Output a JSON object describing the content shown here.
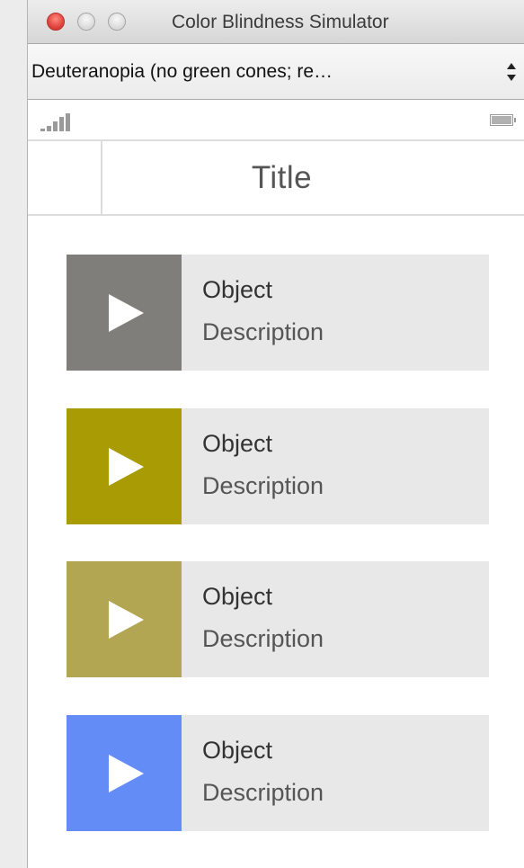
{
  "window": {
    "title": "Color Blindness Simulator"
  },
  "simulation_select": {
    "selected": "Deuteranopia (no green cones; re…"
  },
  "status_bar": {
    "signal_icon": "signal-strength-icon",
    "battery_icon": "battery-icon"
  },
  "nav": {
    "title": "Title"
  },
  "items": [
    {
      "title": "Object",
      "description": "Description",
      "color": "#7f7e7a",
      "icon": "play-icon"
    },
    {
      "title": "Object",
      "description": "Description",
      "color": "#a89b04",
      "icon": "play-icon"
    },
    {
      "title": "Object",
      "description": "Description",
      "color": "#b3a653",
      "icon": "play-icon"
    },
    {
      "title": "Object",
      "description": "Description",
      "color": "#648cf7",
      "icon": "play-icon"
    }
  ]
}
